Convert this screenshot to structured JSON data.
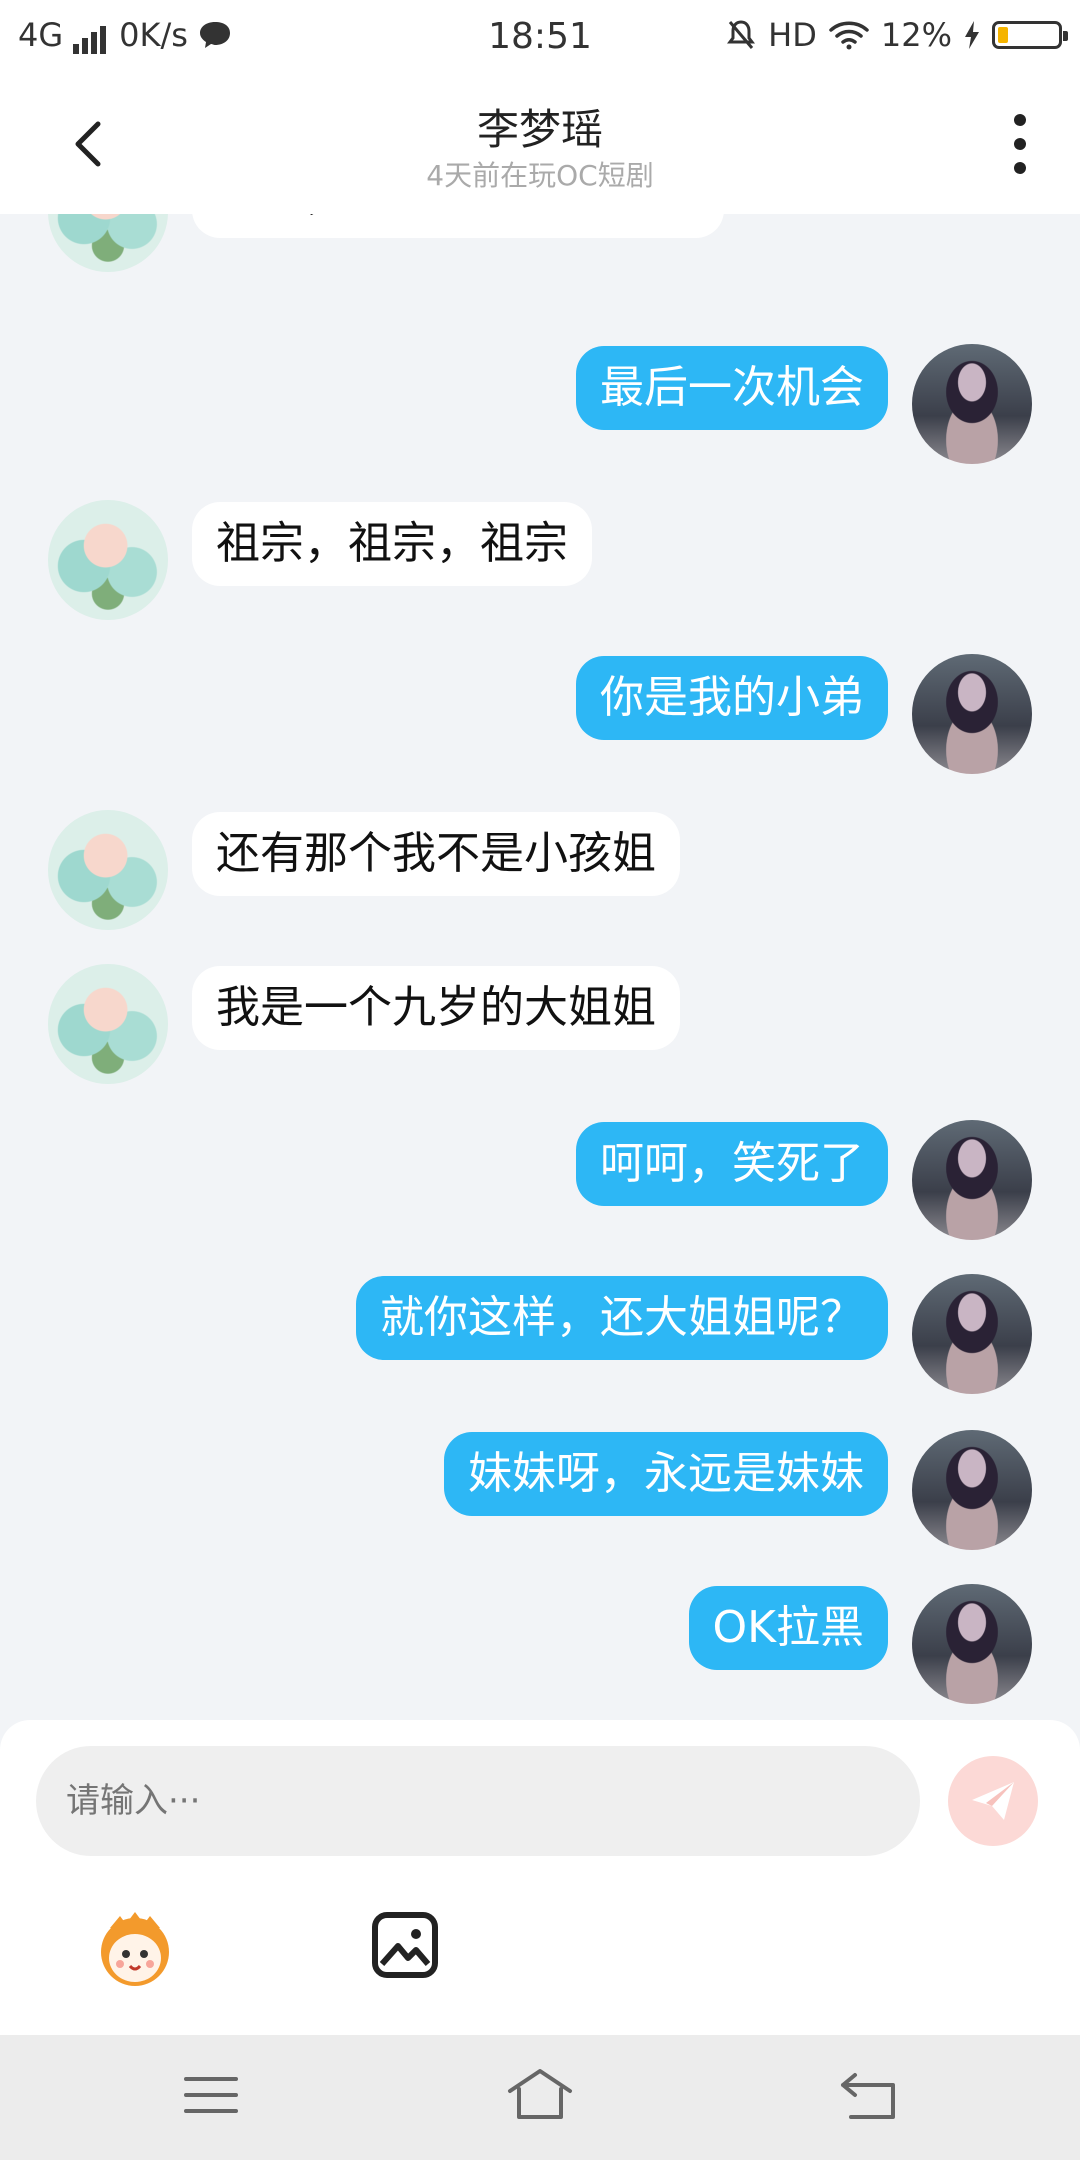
{
  "status_bar": {
    "network": "4G",
    "speed": "0K/s",
    "time": "18:51",
    "hd": "HD",
    "battery": "12%"
  },
  "header": {
    "title": "李梦瑶",
    "subtitle": "4天前在玩OC短剧"
  },
  "messages": [
    {
      "side": "left",
      "text": "大哥，以后你就是我祖宗"
    },
    {
      "side": "right",
      "text": "最后一次机会"
    },
    {
      "side": "left",
      "text": "祖宗，祖宗，祖宗"
    },
    {
      "side": "right",
      "text": "你是我的小弟"
    },
    {
      "side": "left",
      "text": "还有那个我不是小孩姐"
    },
    {
      "side": "left",
      "text": "我是一个九岁的大姐姐"
    },
    {
      "side": "right",
      "text": "呵呵，笑死了"
    },
    {
      "side": "right",
      "text": "就你这样，还大姐姐呢？"
    },
    {
      "side": "right",
      "text": "妹妹呀，永远是妹妹"
    },
    {
      "side": "right",
      "text": "OK拉黑"
    }
  ],
  "composer": {
    "placeholder": "请输入···"
  },
  "icons": {
    "back": "chevron-left-icon",
    "more": "more-vertical-icon",
    "send": "paper-plane-icon",
    "emoji": "emoji-mascot-icon",
    "image": "image-icon",
    "menu": "menu-icon",
    "home": "home-icon",
    "return": "return-icon"
  },
  "colors": {
    "accent": "#2db7f5",
    "send_inactive": "#fcd9d6",
    "background": "#f2f4f7"
  }
}
